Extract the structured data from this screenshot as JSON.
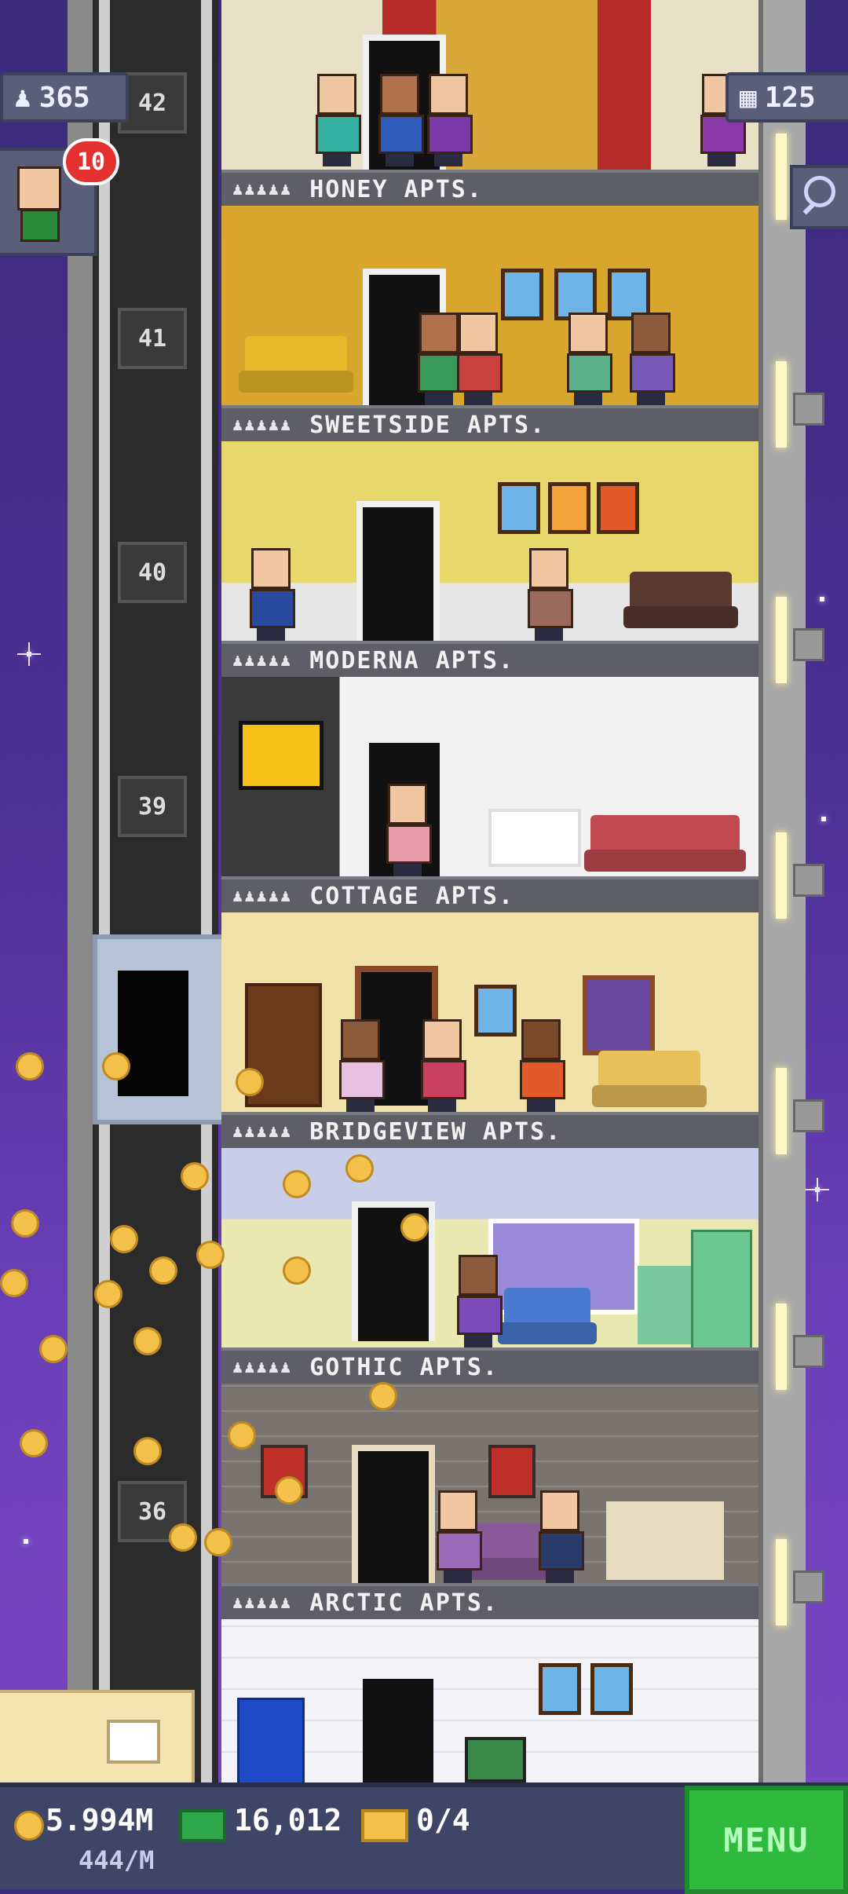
{
  "hud": {
    "population": "365",
    "floors_count": "125",
    "notification_count": "10"
  },
  "elevator": {
    "floor_labels": [
      "42",
      "41",
      "40",
      "39",
      "36"
    ]
  },
  "floors": [
    {
      "name": "HONEY APTS."
    },
    {
      "name": "SWEETSIDE APTS."
    },
    {
      "name": "MODERNA APTS."
    },
    {
      "name": "COTTAGE APTS."
    },
    {
      "name": "BRIDGEVIEW APTS."
    },
    {
      "name": "GOTHIC APTS."
    },
    {
      "name": "ARCTIC APTS."
    }
  ],
  "bottom_bar": {
    "coins": "5.994M",
    "income_rate": "444/M",
    "bux": "16,012",
    "tickets": "0/4",
    "menu_label": "MENU"
  },
  "icons": [
    "person-icon",
    "building-icon",
    "search-icon",
    "coin-icon",
    "bux-icon",
    "ticket-icon",
    "crate-icon"
  ],
  "colors": {
    "sky": "#4b2f93",
    "menu_green": "#2fba3e",
    "coin_gold": "#f3c04a",
    "badge_red": "#e53030"
  }
}
